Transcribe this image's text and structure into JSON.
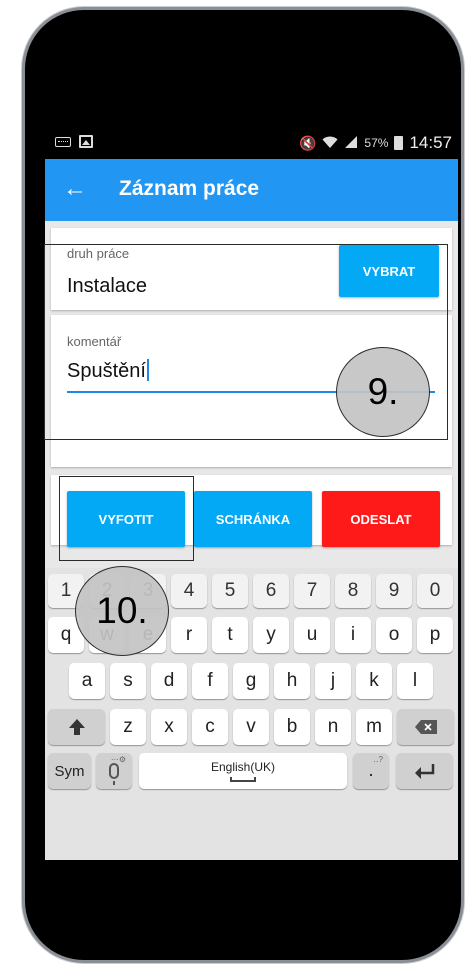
{
  "status_bar": {
    "battery_percent": "57%",
    "time": "14:57"
  },
  "app_bar": {
    "back_icon": "arrow-left-icon",
    "title": "Záznam práce"
  },
  "work_type": {
    "label": "druh práce",
    "value": "Instalace",
    "button": "VYBRAT"
  },
  "comment": {
    "label": "komentář",
    "value": "Spuštění"
  },
  "actions": {
    "photo": "VYFOTIT",
    "clipboard": "SCHRÁNKA",
    "send": "ODESLAT"
  },
  "annotations": {
    "step9": "9.",
    "step10": "10."
  },
  "keyboard": {
    "row_numbers": [
      "1",
      "2",
      "3",
      "4",
      "5",
      "6",
      "7",
      "8",
      "9",
      "0"
    ],
    "row1": [
      "q",
      "w",
      "e",
      "r",
      "t",
      "y",
      "u",
      "i",
      "o",
      "p"
    ],
    "row2": [
      "a",
      "s",
      "d",
      "f",
      "g",
      "h",
      "j",
      "k",
      "l"
    ],
    "row3": [
      "z",
      "x",
      "c",
      "v",
      "b",
      "n",
      "m"
    ],
    "sym": "Sym",
    "space": "English(UK)",
    "period": ".",
    "shift_icon": "shift-arrow-icon",
    "backspace_icon": "backspace-icon",
    "enter_icon": "enter-return-icon",
    "mic_icon": "microphone-icon"
  },
  "colors": {
    "app_bar": "#2196f3",
    "button_blue": "#03a9f4",
    "button_red": "#ff1a1a",
    "underline": "#1e88e5"
  }
}
